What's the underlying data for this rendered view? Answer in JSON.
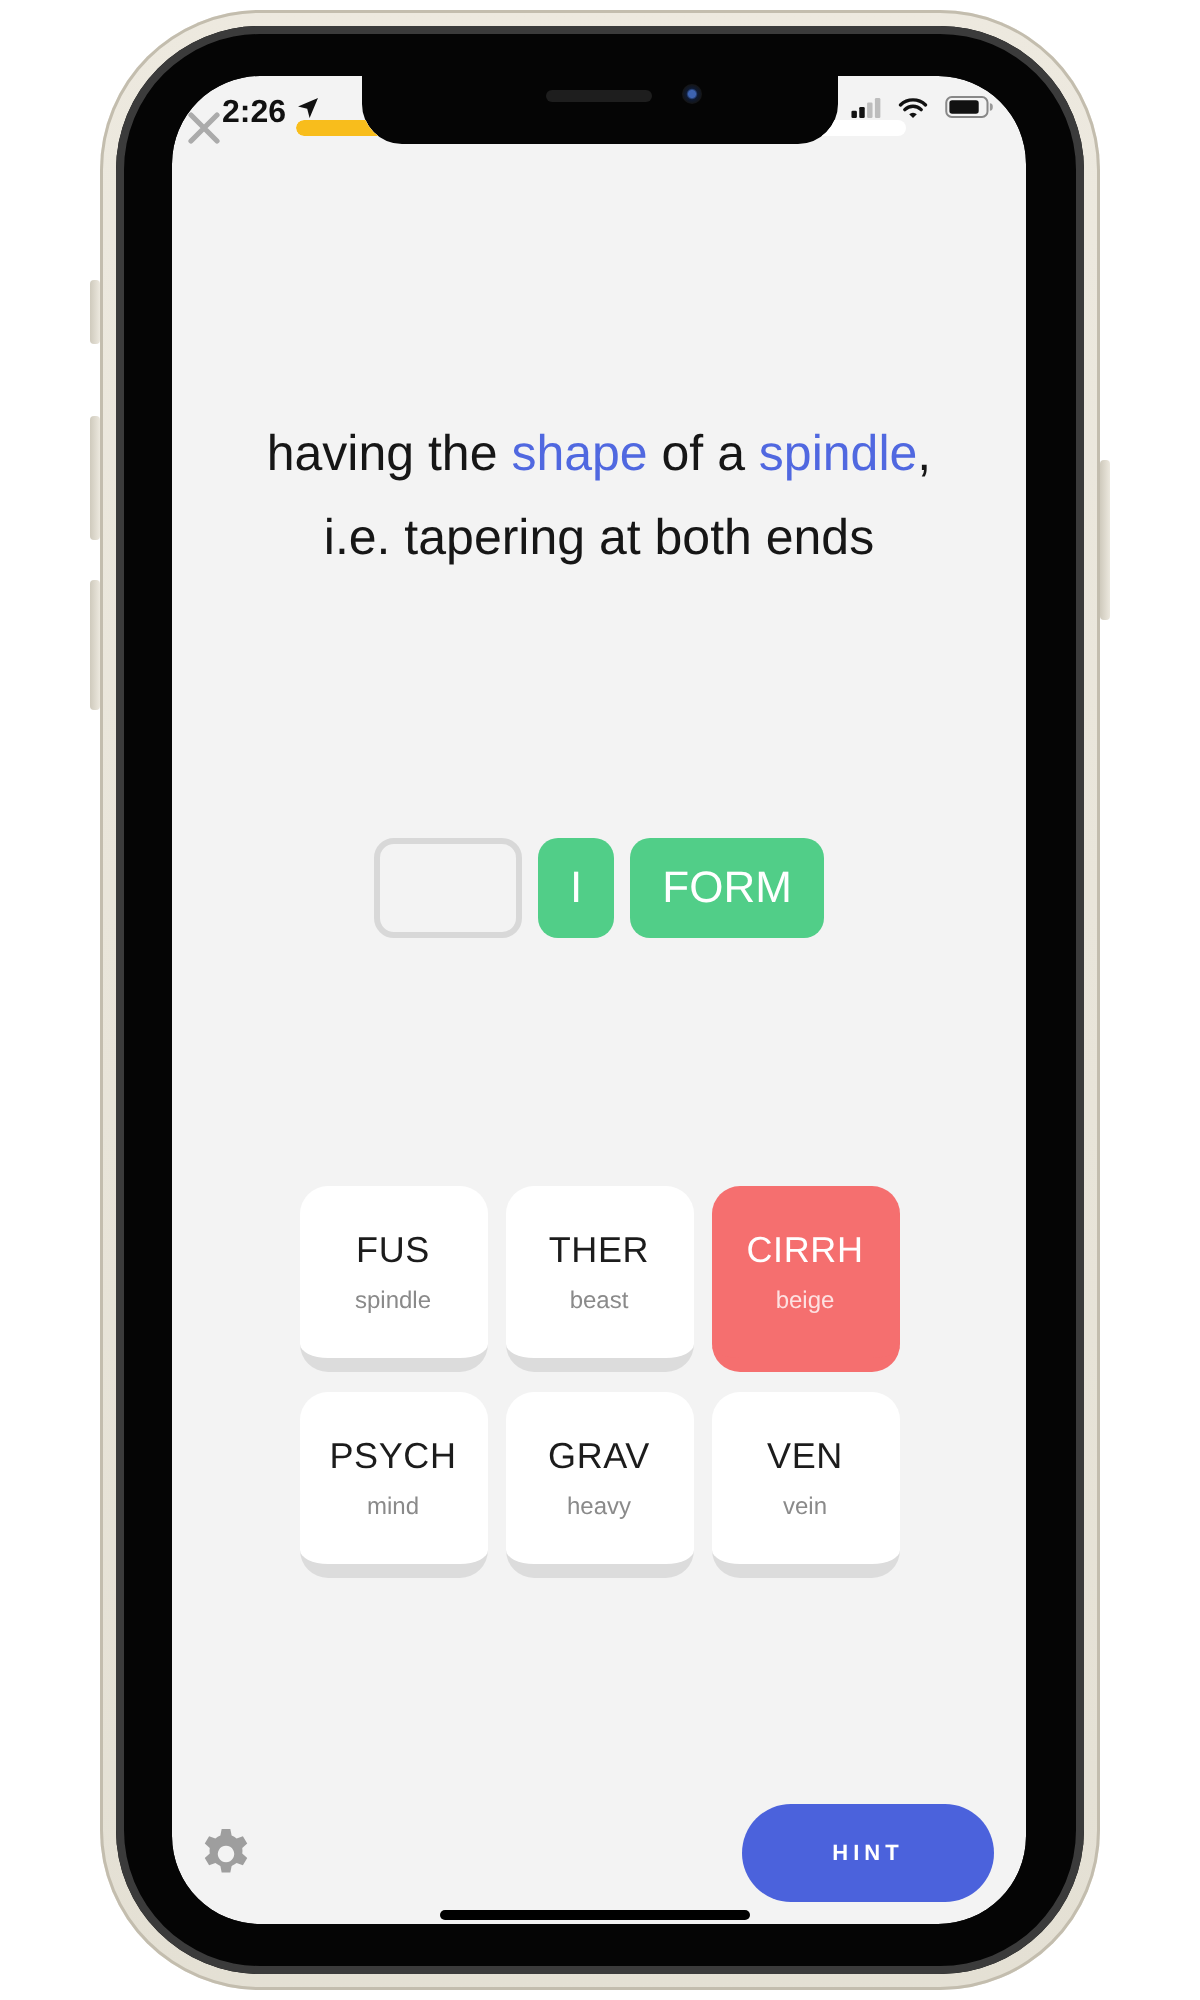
{
  "status_bar": {
    "time": "2:26"
  },
  "header": {
    "progress": {
      "level": 0.16
    }
  },
  "prompt": {
    "segments": [
      {
        "text": "having the ",
        "highlight": false
      },
      {
        "text": "shape",
        "highlight": true
      },
      {
        "text": " of a ",
        "highlight": false
      },
      {
        "text": "spindle",
        "highlight": true
      },
      {
        "text": ", i.e. tapering at both ends",
        "highlight": false
      }
    ]
  },
  "answer": {
    "slots": [
      {
        "kind": "blank"
      },
      {
        "kind": "filled",
        "text": "I"
      },
      {
        "kind": "filled",
        "text": "FORM"
      }
    ]
  },
  "tiles": [
    {
      "root": "FUS",
      "meaning": "spindle",
      "selected": false
    },
    {
      "root": "THER",
      "meaning": "beast",
      "selected": false
    },
    {
      "root": "CIRRH",
      "meaning": "beige",
      "selected": true
    },
    {
      "root": "PSYCH",
      "meaning": "mind",
      "selected": false
    },
    {
      "root": "GRAV",
      "meaning": "heavy",
      "selected": false
    },
    {
      "root": "VEN",
      "meaning": "vein",
      "selected": false
    }
  ],
  "hint_button": {
    "label": "HINT"
  }
}
